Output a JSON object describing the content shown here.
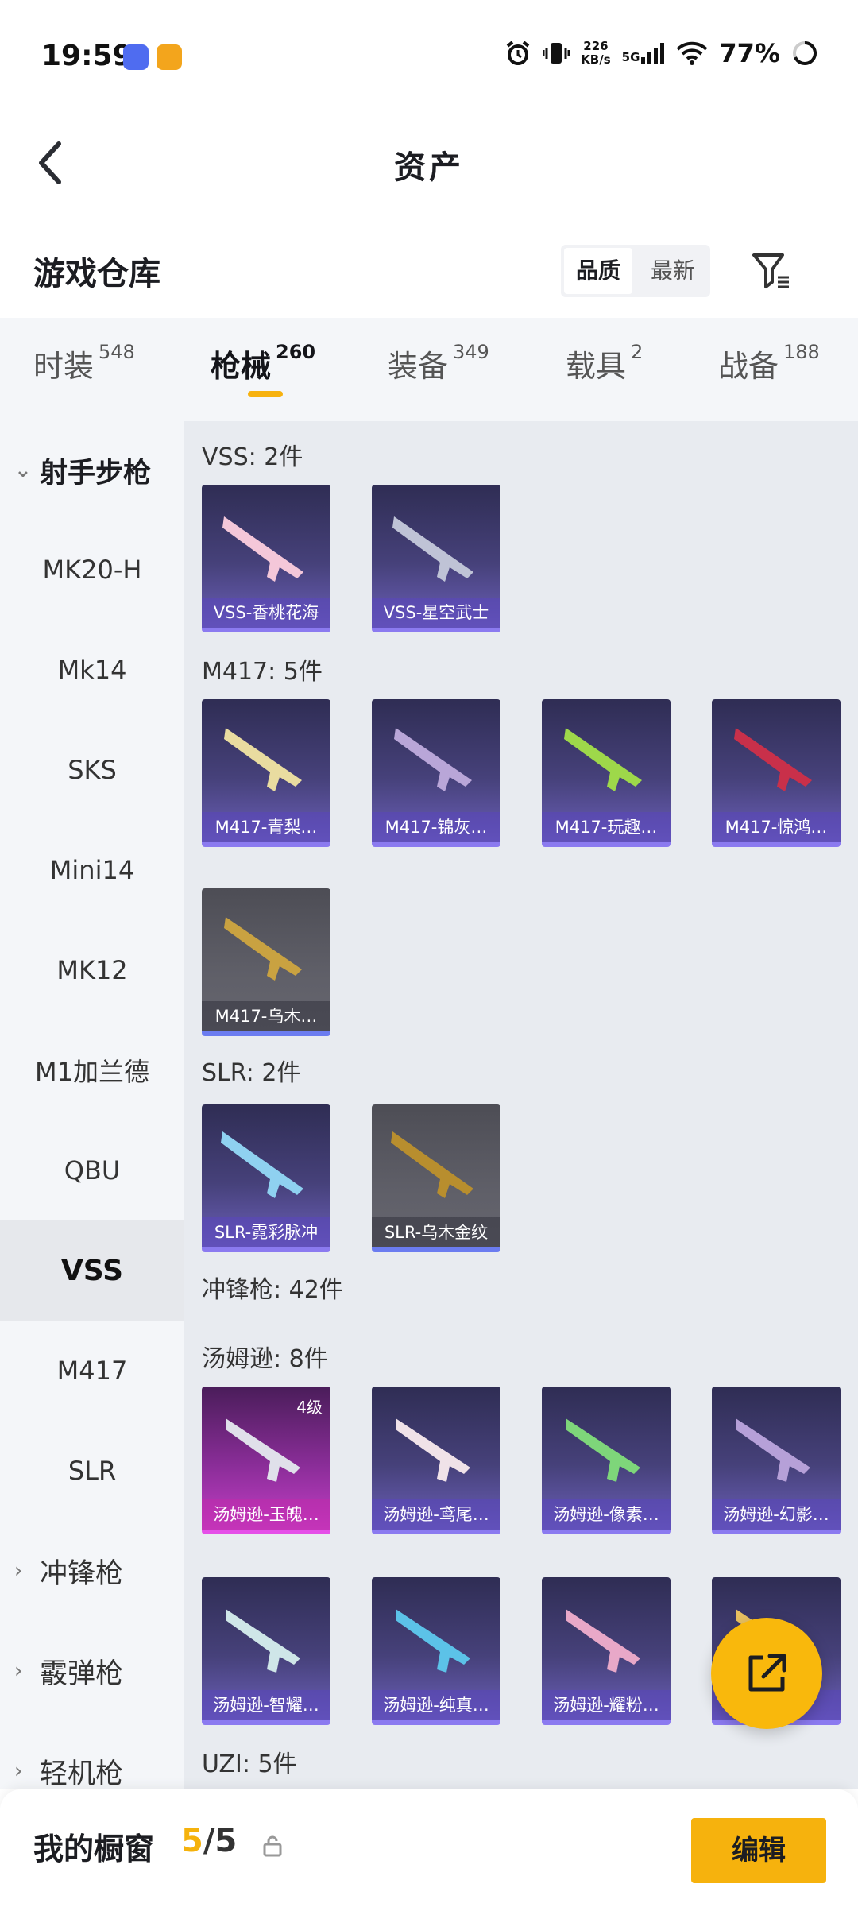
{
  "status": {
    "time": "19:59",
    "speed_top": "226",
    "speed_unit": "KB/s",
    "net": "5G",
    "battery": "77%"
  },
  "header": {
    "title": "资产"
  },
  "section": {
    "title": "游戏仓库",
    "sort_quality": "品质",
    "sort_newest": "最新"
  },
  "tabs": [
    {
      "label": "时装",
      "count": "548"
    },
    {
      "label": "枪械",
      "count": "260"
    },
    {
      "label": "装备",
      "count": "349"
    },
    {
      "label": "载具",
      "count": "2"
    },
    {
      "label": "战备",
      "count": "188"
    }
  ],
  "sidebar": {
    "group_dmr": "射手步枪",
    "items": [
      "MK20-H",
      "Mk14",
      "SKS",
      "Mini14",
      "MK12",
      "M1加兰德",
      "QBU",
      "VSS",
      "M417",
      "SLR"
    ],
    "group_smg": "冲锋枪",
    "group_shotgun": "霰弹枪",
    "group_lmg": "轻机枪"
  },
  "groups": {
    "vss": "VSS: 2件",
    "m417": "M417: 5件",
    "slr": "SLR: 2件",
    "smg": "冲锋枪: 42件",
    "tommy": "汤姆逊: 8件",
    "uzi": "UZI: 5件"
  },
  "cards": {
    "vss": [
      "VSS-香桃花海",
      "VSS-星空武士"
    ],
    "m417": [
      "M417-青梨…",
      "M417-锦灰…",
      "M417-玩趣…",
      "M417-惊鸿…",
      "M417-乌木…"
    ],
    "slr": [
      "SLR-霓彩脉冲",
      "SLR-乌木金纹"
    ],
    "tommy": [
      "汤姆逊-玉魄…",
      "汤姆逊-鸢尾…",
      "汤姆逊-像素…",
      "汤姆逊-幻影…",
      "汤姆逊-智耀…",
      "汤姆逊-纯真…",
      "汤姆逊-耀粉…",
      ""
    ],
    "tommy_badge": "4级"
  },
  "bottom": {
    "title": "我的橱窗",
    "count_current": "5",
    "count_sep": "/5",
    "edit": "编辑"
  },
  "colors": {
    "accent": "#f7b20f",
    "card_purple": "#46417a",
    "card_pink": "#c23ec5",
    "card_gray": "#5f5f68"
  }
}
